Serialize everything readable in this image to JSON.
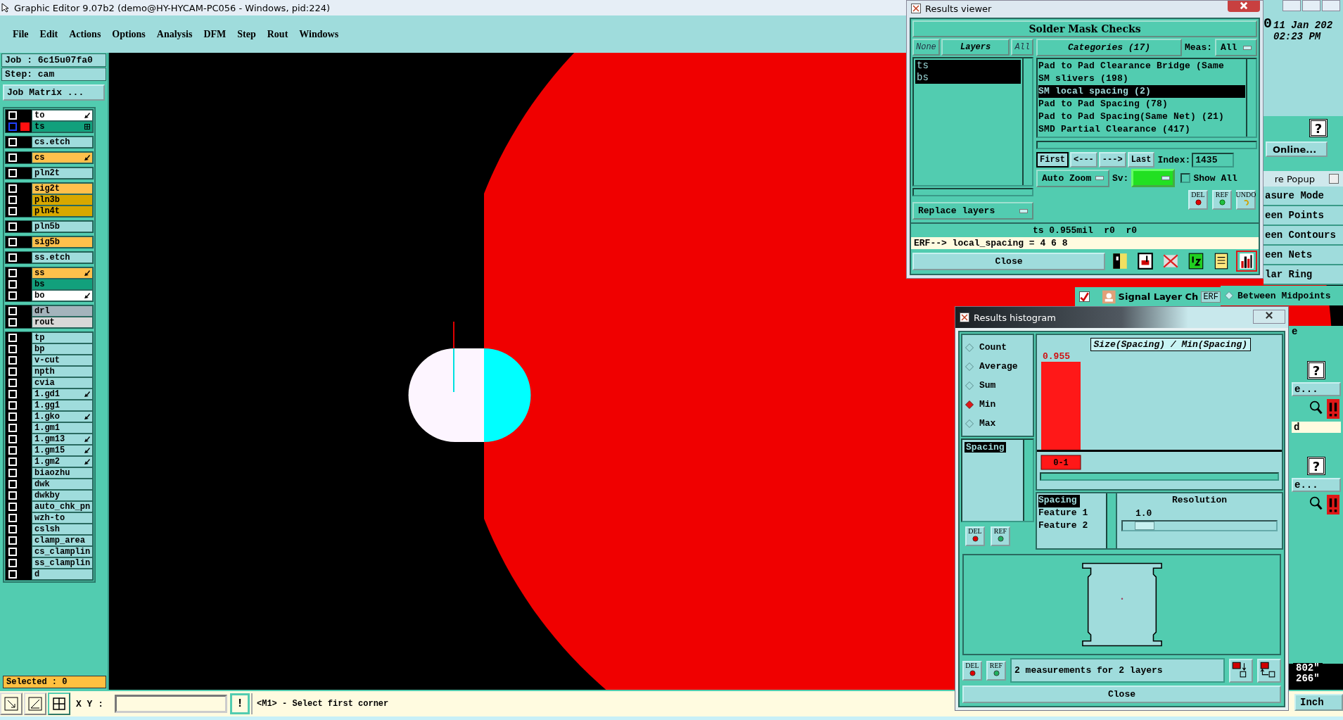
{
  "window": {
    "title": "Graphic Editor 9.07b2 (demo@HY-HYCAM-PC056 - Windows, pid:224)"
  },
  "menu": [
    "File",
    "Edit",
    "Actions",
    "Options",
    "Analysis",
    "DFM",
    "Step",
    "Rout",
    "Windows"
  ],
  "job_info": {
    "job": "Job : 6c15u07fa0",
    "step": "Step: cam"
  },
  "job_matrix_button": "Job Matrix ...",
  "layer_groups": [
    [
      {
        "name": "to",
        "color": "#ffffff",
        "active": false,
        "affected": true
      },
      {
        "name": "ts",
        "color": "#12a07c",
        "active": true,
        "affected": false
      }
    ],
    [
      {
        "name": "cs.etch",
        "color": "#9fdcdc",
        "active": false,
        "affected": false
      }
    ],
    [
      {
        "name": "cs",
        "color": "#ffc04c",
        "active": false,
        "affected": true
      }
    ],
    [
      {
        "name": "pln2t",
        "color": "#9fdcdc",
        "active": false,
        "affected": false
      }
    ],
    [
      {
        "name": "sig2t",
        "color": "#ffc04c",
        "active": false,
        "affected": false
      },
      {
        "name": "pln3b",
        "color": "#d8a800",
        "active": false,
        "affected": false
      },
      {
        "name": "pln4t",
        "color": "#d8a800",
        "active": false,
        "affected": false
      }
    ],
    [
      {
        "name": "pln5b",
        "color": "#9fdcdc",
        "active": false,
        "affected": false
      }
    ],
    [
      {
        "name": "sig5b",
        "color": "#ffc04c",
        "active": false,
        "affected": false
      }
    ],
    [
      {
        "name": "ss.etch",
        "color": "#9fdcdc",
        "active": false,
        "affected": false
      }
    ],
    [
      {
        "name": "ss",
        "color": "#ffc04c",
        "active": false,
        "affected": true
      },
      {
        "name": "bs",
        "color": "#12a07c",
        "active": false,
        "affected": false
      },
      {
        "name": "bo",
        "color": "#ffffff",
        "active": false,
        "affected": true
      }
    ],
    [
      {
        "name": "drl",
        "color": "#a4b4bc",
        "active": false,
        "affected": false
      },
      {
        "name": "rout",
        "color": "#d8d8d8",
        "active": false,
        "affected": false
      }
    ],
    [
      {
        "name": "tp",
        "color": "#9fdcdc",
        "active": false,
        "affected": false
      },
      {
        "name": "bp",
        "color": "#9fdcdc",
        "active": false,
        "affected": false
      },
      {
        "name": "v-cut",
        "color": "#9fdcdc",
        "active": false,
        "affected": false
      },
      {
        "name": "npth",
        "color": "#9fdcdc",
        "active": false,
        "affected": false
      },
      {
        "name": "cvia",
        "color": "#9fdcdc",
        "active": false,
        "affected": false
      },
      {
        "name": "1.gd1",
        "color": "#9fdcdc",
        "active": false,
        "affected": true
      },
      {
        "name": "1.gg1",
        "color": "#9fdcdc",
        "active": false,
        "affected": false
      },
      {
        "name": "1.gko",
        "color": "#9fdcdc",
        "active": false,
        "affected": true
      },
      {
        "name": "1.gm1",
        "color": "#9fdcdc",
        "active": false,
        "affected": false
      },
      {
        "name": "1.gm13",
        "color": "#9fdcdc",
        "active": false,
        "affected": true
      },
      {
        "name": "1.gm15",
        "color": "#9fdcdc",
        "active": false,
        "affected": true
      },
      {
        "name": "1.gm2",
        "color": "#9fdcdc",
        "active": false,
        "affected": true
      },
      {
        "name": "biaozhu",
        "color": "#9fdcdc",
        "active": false,
        "affected": false
      },
      {
        "name": "dwk",
        "color": "#9fdcdc",
        "active": false,
        "affected": false
      },
      {
        "name": "dwkby",
        "color": "#9fdcdc",
        "active": false,
        "affected": false
      },
      {
        "name": "auto_chk_pn",
        "color": "#9fdcdc",
        "active": false,
        "affected": false
      },
      {
        "name": "wzh-to",
        "color": "#9fdcdc",
        "active": false,
        "affected": false
      },
      {
        "name": "cslsh",
        "color": "#9fdcdc",
        "active": false,
        "affected": false
      },
      {
        "name": "clamp_area",
        "color": "#9fdcdc",
        "active": false,
        "affected": false
      },
      {
        "name": "cs_clamplin",
        "color": "#9fdcdc",
        "active": false,
        "affected": false
      },
      {
        "name": "ss_clamplin",
        "color": "#9fdcdc",
        "active": false,
        "affected": false
      },
      {
        "name": "d",
        "color": "#9fdcdc",
        "active": false,
        "affected": false
      }
    ]
  ],
  "selected_count": "Selected : 0",
  "bottom_bar": {
    "xy_label": "X Y :",
    "hint_button": "!",
    "message": "<M1> - Select first corner",
    "units": "Inch"
  },
  "results_viewer": {
    "title": "Results viewer",
    "heading": "Solder Mask Checks",
    "layer_buttons": [
      {
        "label": "None",
        "selected": false
      },
      {
        "label": "Layers",
        "selected": true
      },
      {
        "label": "All",
        "selected": false
      }
    ],
    "layers": [
      {
        "name": "ts",
        "selected": true
      },
      {
        "name": "bs",
        "selected": true
      }
    ],
    "replace_menu": "Replace layers",
    "categories_button": "Categories (17)",
    "meas_label": "Meas:",
    "meas_value": "All",
    "categories": [
      {
        "label": "Pad to Pad Clearance Bridge (Same",
        "selected": false
      },
      {
        "label": "SM slivers (198)",
        "selected": false
      },
      {
        "label": "SM local spacing (2)",
        "selected": true
      },
      {
        "label": "Pad to Pad Spacing (78)",
        "selected": false
      },
      {
        "label": "Pad to Pad Spacing(Same Net) (21)",
        "selected": false
      },
      {
        "label": "SMD Partial Clearance (417)",
        "selected": false
      }
    ],
    "nav": [
      "First",
      "<---",
      "--->",
      "Last"
    ],
    "index_label": "Index:",
    "index_value": "1435",
    "zoom_menu": "Auto Zoom",
    "sv_label": "Sv:",
    "show_all": {
      "label": "Show All",
      "checked": false
    },
    "action_buttons": [
      "DEL",
      "REF",
      "UNDO"
    ],
    "measurement": "ts 0.955mil  r0  r0",
    "erf": "ERF--> local_spacing = 4 6 8",
    "close": "Close",
    "tools": [
      {
        "kind": "split",
        "selected": false
      },
      {
        "kind": "layer",
        "selected": false
      },
      {
        "kind": "noref",
        "selected": false
      },
      {
        "kind": "numbers",
        "selected": false
      },
      {
        "kind": "report",
        "selected": false
      },
      {
        "kind": "histogram",
        "selected": true
      }
    ]
  },
  "histogram": {
    "title": "Results histogram",
    "modes": [
      {
        "label": "Count",
        "selected": false
      },
      {
        "label": "Average",
        "selected": false
      },
      {
        "label": "Sum",
        "selected": false
      },
      {
        "label": "Min",
        "selected": true
      },
      {
        "label": "Max",
        "selected": false
      }
    ],
    "attributes": [
      {
        "label": "Spacing",
        "selected": true
      }
    ],
    "buttons": [
      "DEL",
      "REF"
    ],
    "chart": {
      "title": "Size(Spacing) / Min(Spacing)",
      "bins": [
        {
          "range": "0-1",
          "value": "0.955"
        }
      ]
    },
    "fields": [
      {
        "label": "Spacing",
        "selected": true
      },
      {
        "label": "Feature 1",
        "selected": false
      },
      {
        "label": "Feature 2",
        "selected": false
      }
    ],
    "resolution": {
      "label": "Resolution",
      "value": "1.0",
      "level": 0.08
    },
    "footer_buttons": [
      "DEL",
      "REF"
    ],
    "summary": "2 measurements for 2 layers",
    "close": "Close"
  },
  "background": {
    "clock": {
      "date": "11 Jan 202",
      "time": "02:23 PM"
    },
    "edge_digit": "0",
    "upper_panel": {
      "help": "?",
      "online": "Online..."
    },
    "measure_popup": {
      "title": "re Popup",
      "items": [
        "asure Mode",
        "een Points",
        "een Contours",
        "een Nets",
        "lar Ring"
      ],
      "option": {
        "label": "Between Midpoints",
        "selected": false
      }
    },
    "check_row": {
      "checked": true,
      "label": "Signal Layer Ch",
      "erf": "ERF"
    },
    "lower_panel": {
      "label": "e",
      "rows": [
        {
          "help": "?",
          "more": "e...",
          "field": "d"
        },
        {
          "help": "?",
          "more": "e..."
        }
      ]
    },
    "coords": [
      "802\"",
      "266\""
    ]
  }
}
